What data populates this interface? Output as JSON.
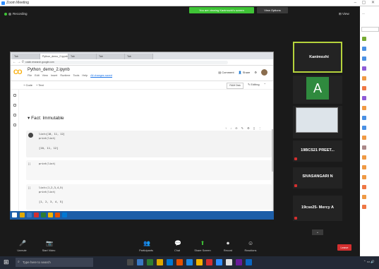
{
  "app": {
    "title": "Zoom Meeting"
  },
  "share_banner": {
    "text": "You are viewing Kanimozhi's screen",
    "stop_label": "View Options"
  },
  "meeting": {
    "tag_label": "Recording",
    "view_label": "View"
  },
  "browser": {
    "tabs": [
      "Tab",
      "Python_demo_2.ipynb",
      "Tab",
      "Tab",
      "Tab"
    ],
    "url": "colab.research.google.com",
    "notebook_title": "Python_demo_2.ipynb",
    "menu": [
      "File",
      "Edit",
      "View",
      "Insert",
      "Runtime",
      "Tools",
      "Help",
      "All changes saved"
    ],
    "comment_label": "Comment",
    "share_label": "Share",
    "toolbar_left": [
      "+ Code",
      "+ Text"
    ],
    "ram_label": "RAM Disk",
    "editing_label": "Editing",
    "section_title": "Fact: Immutable",
    "cells": [
      {
        "label": "",
        "code": [
          "list=[10, 11, 12]",
          "print(list)"
        ],
        "output": "[10, 11, 12]"
      },
      {
        "label": "[ ]",
        "code": [
          "print(list)"
        ],
        "output": ""
      },
      {
        "label": "[ ]",
        "code": [
          "list=(1,2,3,4,5)",
          "print(list)"
        ],
        "output": "[1, 2, 3, 4, 5]"
      }
    ]
  },
  "participants": [
    {
      "name": "Kanimozhi"
    },
    {
      "name": "",
      "initial": "A",
      "sub": ""
    },
    {
      "name": "",
      "sub": ""
    },
    {
      "name": "19BCS21  PREET..."
    },
    {
      "name": "SIVASANGARI N"
    },
    {
      "name": "19cse25- Mercy A"
    }
  ],
  "controls": [
    {
      "label": "Unmute",
      "icon": "🎤"
    },
    {
      "label": "Start Video",
      "icon": "📷"
    },
    {
      "label": "Participants",
      "icon": "👥"
    },
    {
      "label": "Chat",
      "icon": "💬"
    },
    {
      "label": "Share Screen",
      "icon": "⬆"
    },
    {
      "label": "Record",
      "icon": "⏺"
    },
    {
      "label": "Reactions",
      "icon": "☺"
    }
  ],
  "end_label": "Leave",
  "side_panel": {
    "search_placeholder": "",
    "rows": [
      "",
      "",
      "",
      "",
      "",
      "",
      "",
      "",
      "",
      "",
      "",
      "",
      "",
      "",
      "",
      "",
      "",
      ""
    ],
    "row_colors": [
      "#7a3",
      "#4a90e2",
      "#4a90e2",
      "#8e5bd6",
      "#e94",
      "#e74",
      "#8e5bd6",
      "#e94",
      "#4a90e2",
      "#4a90e2",
      "#e94",
      "#a88",
      "#e94",
      "#e94",
      "#e94",
      "#e74",
      "#e94",
      "#e74"
    ]
  },
  "windows": {
    "search_placeholder": "Type here to search",
    "taskbar_colors": [
      "#4a4a4a",
      "#3a78c3",
      "#2e7d32",
      "#e0a800",
      "#0078d4",
      "#e65100",
      "#1e88e5",
      "#f4b400",
      "#d32f2f",
      "#2d8cff",
      "#e0e0e0",
      "#6a1b9a",
      "#0a66c2"
    ]
  },
  "colors": {
    "accent": "#2d8cff",
    "share_green": "#3fc436",
    "end_red": "#d32f2f"
  }
}
